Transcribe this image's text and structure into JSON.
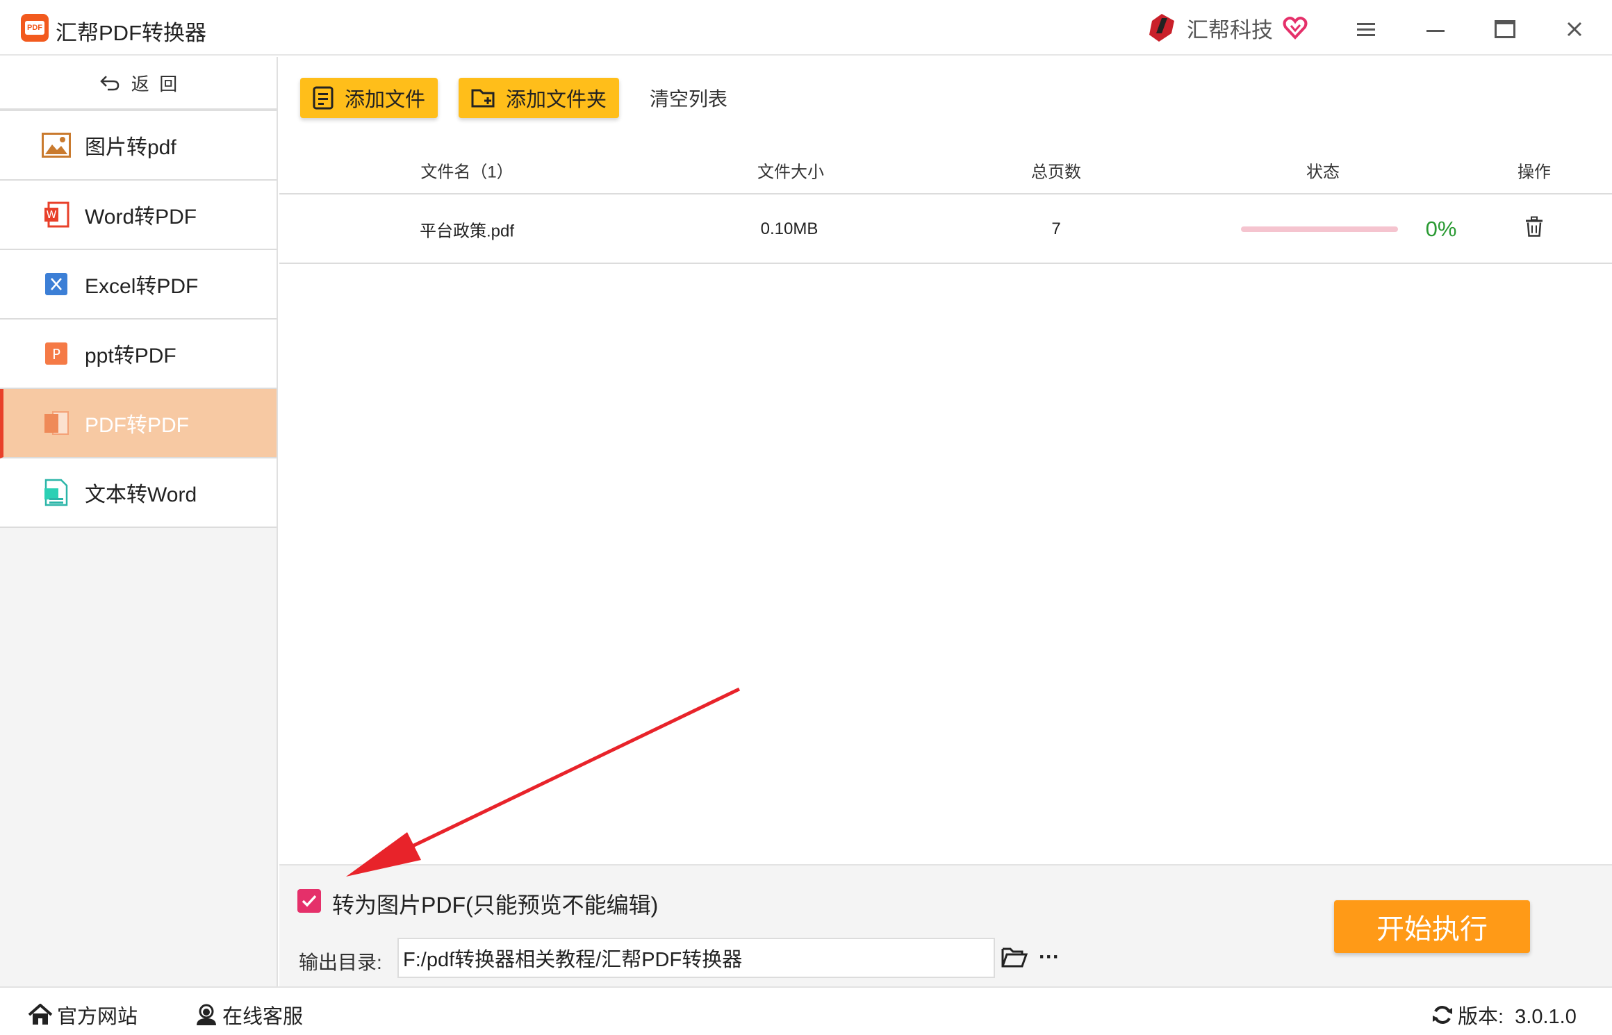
{
  "app": {
    "title": "汇帮PDF转换器",
    "brand": "汇帮科技",
    "logo_text": "PDF"
  },
  "sidebar": {
    "back_label": "返  回",
    "items": [
      {
        "label": "图片转pdf",
        "icon": "image-icon"
      },
      {
        "label": "Word转PDF",
        "icon": "word-icon"
      },
      {
        "label": "Excel转PDF",
        "icon": "excel-icon"
      },
      {
        "label": "ppt转PDF",
        "icon": "ppt-icon"
      },
      {
        "label": "PDF转PDF",
        "icon": "pdf-icon",
        "active": true
      },
      {
        "label": "文本转Word",
        "icon": "text-icon"
      }
    ]
  },
  "toolbar": {
    "add_file": "添加文件",
    "add_folder": "添加文件夹",
    "clear_list": "清空列表"
  },
  "table": {
    "headers": [
      "文件名（1）",
      "文件大小",
      "总页数",
      "状态",
      "操作"
    ],
    "rows": [
      {
        "name": "平台政策.pdf",
        "size": "0.10MB",
        "pages": "7",
        "progress": 0,
        "status": "0%"
      }
    ]
  },
  "options": {
    "convert_to_image_pdf": {
      "label": "转为图片PDF(只能预览不能编辑)",
      "checked": true
    },
    "output_label": "输出目录:",
    "output_path": "F:/pdf转换器相关教程/汇帮PDF转换器",
    "more_label": "···",
    "start_button": "开始执行"
  },
  "statusbar": {
    "website": "官方网站",
    "support": "在线客服",
    "version": "版本:  3.0.1.0"
  },
  "colors": {
    "accent_orange": "#ff9a17",
    "button_yellow": "#ffbe1a",
    "active_nav": "#f7c9a3",
    "checkbox": "#e5306a",
    "progress_green": "#2a9a33",
    "annotation_red": "#e8232a"
  }
}
